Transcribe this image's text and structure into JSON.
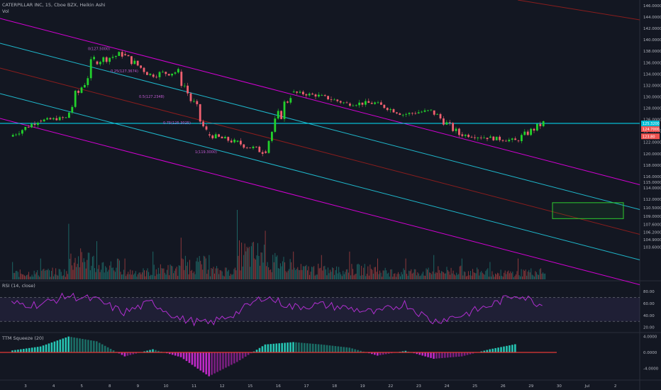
{
  "header": {
    "title": "CATERPILLAR INC, 15, Cboe BZX, Heikin Ashi",
    "vol_label": "Vol",
    "rsi_label": "RSI (14, close)",
    "ttm_label": "TTM Squeeze (20)"
  },
  "colors": {
    "background": "#131722",
    "bull": "#26a69a",
    "bear": "#ef5350",
    "candle_bull": "#22d12c",
    "candle_bear": "#f06070",
    "channel_magenta": "#d400d4",
    "channel_cyan": "#1fb8cc",
    "channel_red": "#8a1d1d",
    "rsi_line": "#b02fd0",
    "box": "#2ecc2e",
    "hline": "#00e5ff"
  },
  "chart_data": [
    {
      "type": "candlestick",
      "name": "price",
      "x": [
        "3",
        "4",
        "5",
        "8",
        "9",
        "10",
        "11",
        "12",
        "15",
        "16",
        "17",
        "18",
        "19",
        "22",
        "23",
        "24",
        "25",
        "26",
        "29",
        "30",
        "Jul",
        "2"
      ],
      "ohlc_daily": [
        [
          123.0,
          126.6,
          122.8,
          125.8
        ],
        [
          125.8,
          127.2,
          124.9,
          126.3
        ],
        [
          126.3,
          138.8,
          126.0,
          136.2
        ],
        [
          136.2,
          139.0,
          133.8,
          137.5
        ],
        [
          137.5,
          138.2,
          133.0,
          133.9
        ],
        [
          133.9,
          135.3,
          130.6,
          134.4
        ],
        [
          134.4,
          134.8,
          121.5,
          123.4
        ],
        [
          123.4,
          124.6,
          121.0,
          122.1
        ],
        [
          122.1,
          123.8,
          119.3,
          120.4
        ],
        [
          120.4,
          132.0,
          120.0,
          130.8
        ],
        [
          130.8,
          131.4,
          129.0,
          130.2
        ],
        [
          130.2,
          130.9,
          128.2,
          128.8
        ],
        [
          128.8,
          130.0,
          127.0,
          128.9
        ],
        [
          128.9,
          129.4,
          126.4,
          126.9
        ],
        [
          126.9,
          128.2,
          126.0,
          127.6
        ],
        [
          127.6,
          127.9,
          122.7,
          123.4
        ],
        [
          123.4,
          124.1,
          121.6,
          122.8
        ],
        [
          122.8,
          124.8,
          122.0,
          122.3
        ],
        [
          122.3,
          126.5,
          121.8,
          125.4
        ]
      ],
      "y_axis_ticks": [
        "146.0000",
        "144.0000",
        "142.0000",
        "140.0000",
        "138.0000",
        "136.0000",
        "134.0000",
        "132.0000",
        "130.0000",
        "128.0000",
        "126.0000",
        "124.0000",
        "122.0000",
        "120.0000",
        "118.0000",
        "116.0000",
        "115.0000",
        "114.0000",
        "112.0000",
        "110.5000",
        "109.0000",
        "107.6000",
        "106.2000",
        "104.9000",
        "103.6000"
      ],
      "price_tags": [
        {
          "text": "125.3200",
          "value": 125.32,
          "color": "#00bcd4"
        },
        {
          "text": "124.7000",
          "value": 124.7,
          "color": "#ef5350"
        },
        {
          "text": "123.80",
          "value": 123.8,
          "color": "#ef5350"
        }
      ],
      "fib_labels": [
        {
          "text": "0(127.5000)",
          "value": 138.2
        },
        {
          "text": "0.25(127.3674)",
          "value": 134.3
        },
        {
          "text": "0.5(127.2348)",
          "value": 129.8
        },
        {
          "text": "0.75(125.3025)",
          "value": 125.2
        },
        {
          "text": "1(119.3000)",
          "value": 120.1
        }
      ],
      "horizontal_line": 125.32,
      "target_box": {
        "y_top": 111.4,
        "y_bottom": 108.6
      }
    },
    {
      "type": "bar",
      "name": "volume",
      "x": [
        "3",
        "4",
        "5",
        "8",
        "9",
        "10",
        "11",
        "12",
        "15",
        "16",
        "17",
        "18",
        "19",
        "22",
        "23",
        "24",
        "25",
        "26",
        "29",
        "30",
        "Jul",
        "2"
      ],
      "daily_peak_relative": [
        0.25,
        0.3,
        0.8,
        0.55,
        0.3,
        0.4,
        0.6,
        0.35,
        1.0,
        0.7,
        0.4,
        0.35,
        0.4,
        0.3,
        0.3,
        0.35,
        0.3,
        0.25,
        0.3
      ]
    },
    {
      "type": "line",
      "name": "RSI (14, close)",
      "y_axis_ticks": [
        "80.00",
        "60.00",
        "40.00",
        "20.00"
      ],
      "ylim": [
        10,
        90
      ],
      "bands": [
        70,
        30
      ],
      "values": [
        60,
        58,
        73,
        66,
        45,
        62,
        34,
        26,
        44,
        72,
        54,
        58,
        52,
        44,
        60,
        30,
        40,
        56,
        76,
        55
      ]
    },
    {
      "type": "bar",
      "name": "TTM Squeeze (20)",
      "y_axis_ticks": [
        "4.0000",
        "0.0000",
        "-4.0000"
      ],
      "ylim": [
        -6.5,
        5.5
      ],
      "values": [
        0.5,
        1.5,
        4.0,
        2.8,
        -1.0,
        0.8,
        -1.2,
        -6.0,
        -2.4,
        2.0,
        2.6,
        2.0,
        1.2,
        -0.8,
        0.4,
        -1.6,
        -1.0,
        0.8,
        2.2
      ]
    }
  ]
}
